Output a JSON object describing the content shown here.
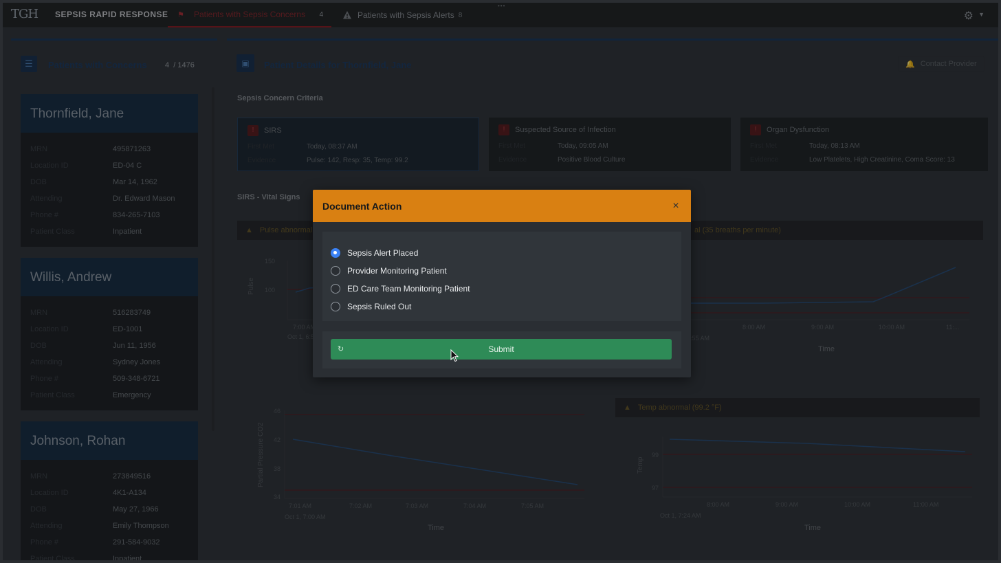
{
  "topbar": {
    "logo": "TGH",
    "title": "SEPSIS RAPID RESPONSE",
    "tab_concerns_label": "Patients with Sepsis Concerns",
    "tab_concerns_count": "4",
    "tab_alerts_label": "Patients with Sepsis Alerts",
    "tab_alerts_count": "8"
  },
  "left_panel": {
    "title": "Patients with Concerns",
    "count": "4",
    "total": "/ 1476",
    "patients": [
      {
        "name": "Thornfield, Jane",
        "rows": [
          {
            "label": "MRN",
            "value": "495871263"
          },
          {
            "label": "Location ID",
            "value": "ED-04 C"
          },
          {
            "label": "DOB",
            "value": "Mar 14, 1962"
          },
          {
            "label": "Attending",
            "value": "Dr. Edward Mason"
          },
          {
            "label": "Phone #",
            "value": "834-265-7103"
          },
          {
            "label": "Patient Class",
            "value": "Inpatient"
          }
        ]
      },
      {
        "name": "Willis, Andrew",
        "rows": [
          {
            "label": "MRN",
            "value": "516283749"
          },
          {
            "label": "Location ID",
            "value": "ED-1001"
          },
          {
            "label": "DOB",
            "value": "Jun 11, 1956"
          },
          {
            "label": "Attending",
            "value": "Sydney Jones"
          },
          {
            "label": "Phone #",
            "value": "509-348-6721"
          },
          {
            "label": "Patient Class",
            "value": "Emergency"
          }
        ]
      },
      {
        "name": "Johnson, Rohan",
        "rows": [
          {
            "label": "MRN",
            "value": "273849516"
          },
          {
            "label": "Location ID",
            "value": "4K1-A134"
          },
          {
            "label": "DOB",
            "value": "May 27, 1966"
          },
          {
            "label": "Attending",
            "value": "Emily Thompson"
          },
          {
            "label": "Phone #",
            "value": "291-584-9032"
          },
          {
            "label": "Patient Class",
            "value": "Inpatient"
          }
        ]
      }
    ]
  },
  "main": {
    "title": "Patient Details for Thornfield, Jane",
    "contact_button": "Contact Provider",
    "criteria_label": "Sepsis Concern Criteria",
    "criteria": [
      {
        "title": "SIRS",
        "first_met_label": "First Met",
        "first_met": "Today, 08:37 AM",
        "evidence_label": "Evidence",
        "evidence": "Pulse: 142, Resp: 35, Temp: 99.2"
      },
      {
        "title": "Suspected Source of Infection",
        "first_met_label": "First Met",
        "first_met": "Today, 09:05 AM",
        "evidence_label": "Evidence",
        "evidence": "Positive Blood Culture"
      },
      {
        "title": "Organ Dysfunction",
        "first_met_label": "First Met",
        "first_met": "Today, 08:13 AM",
        "evidence_label": "Evidence",
        "evidence": "Low Platelets, High Creatinine, Coma Score: 13"
      }
    ],
    "vitals_label": "SIRS - Vital Signs",
    "pulse_warning": "Pulse abnormal",
    "resp_warning": "al (35 breaths per minute)",
    "temp_warning": "Temp abnormal (99.2 °F)"
  },
  "charts": {
    "pulse": {
      "ylabel": "Pulse",
      "yticks": [
        "150",
        "100"
      ],
      "xticks": [
        "7:00 AM"
      ],
      "start": "Oct 1, 6:5"
    },
    "resp": {
      "xticks": [
        "8:00 AM",
        "9:00 AM",
        "10:00 AM",
        "11:..."
      ],
      "start": ":55 AM",
      "xlabel": "Time"
    },
    "pco2": {
      "ylabel": "Partial Pressure CO2",
      "yticks": [
        "46",
        "42",
        "38",
        "34"
      ],
      "xticks": [
        "7:01 AM",
        "7:02 AM",
        "7:03 AM",
        "7:04 AM",
        "7:05 AM"
      ],
      "start": "Oct 1, 7:00 AM",
      "xlabel": "Time"
    },
    "temp": {
      "ylabel": "Temp",
      "yticks": [
        "99",
        "97"
      ],
      "xticks": [
        "8:00 AM",
        "9:00 AM",
        "10:00 AM",
        "11:00 AM"
      ],
      "start": "Oct 1, 7:24 AM",
      "xlabel": "Time"
    }
  },
  "modal": {
    "title": "Document Action",
    "close": "×",
    "options": [
      {
        "label": "Sepsis Alert Placed",
        "checked": true
      },
      {
        "label": "Provider Monitoring Patient",
        "checked": false
      },
      {
        "label": "ED Care Team Monitoring Patient",
        "checked": false
      },
      {
        "label": "Sepsis Ruled Out",
        "checked": false
      }
    ],
    "submit_label": "Submit"
  },
  "colors": {
    "modal_header": "#d98012",
    "submit": "#2e8b57",
    "radio_checked": "#3b82f6",
    "concern_red": "#a8323a"
  }
}
